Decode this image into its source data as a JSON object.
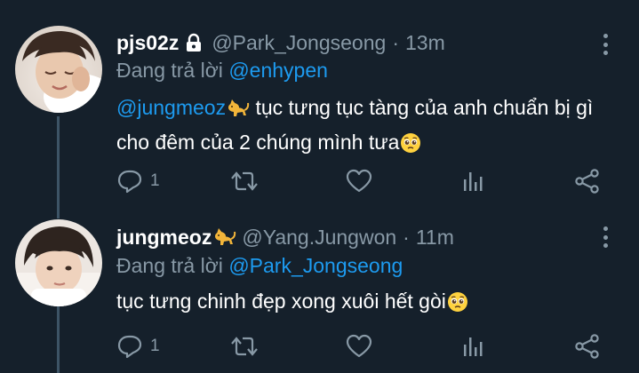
{
  "colors": {
    "background": "#15202b",
    "secondary_text": "#8899a6",
    "link": "#1d9bf0",
    "thread_line": "#3d5466"
  },
  "tweets": [
    {
      "display_name": "pjs02z",
      "badge_icon": "lock-icon",
      "handle": "@Park_Jongseong",
      "separator": "·",
      "time": "13m",
      "reply_prefix": "Đang trả lời",
      "reply_to": "@enhypen",
      "body_mention": "@jungmeoz",
      "body_text": " tục tưng tục tàng của anh chuẩn bị gì cho đêm của 2 chúng mình tưa",
      "body_emoji": "pleading-face-emoji",
      "reply_count": "1",
      "actions": [
        "reply-icon",
        "retweet-icon",
        "like-icon",
        "analytics-icon",
        "share-icon"
      ]
    },
    {
      "display_name": "jungmeoz",
      "badge_icon": "cat-icon",
      "handle": "@Yang.Jungwon",
      "separator": "·",
      "time": "11m",
      "reply_prefix": "Đang trả lời",
      "reply_to": "@Park_Jongseong",
      "body_mention": "",
      "body_text": "tục tưng chinh đẹp xong xuôi hết gòi",
      "body_emoji": "pleading-face-emoji",
      "reply_count": "1",
      "actions": [
        "reply-icon",
        "retweet-icon",
        "like-icon",
        "analytics-icon",
        "share-icon"
      ]
    }
  ]
}
